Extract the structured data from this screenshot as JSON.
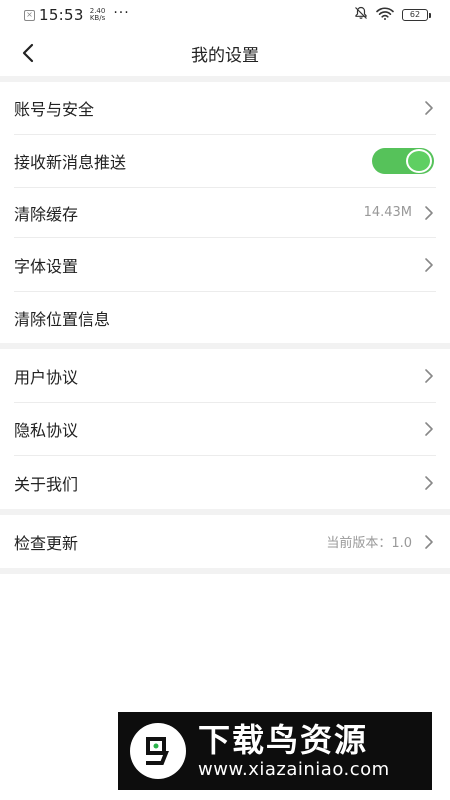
{
  "status_bar": {
    "time": "15:53",
    "speed_value": "2.40",
    "speed_unit": "KB/s",
    "more_dots": "···",
    "battery": "62"
  },
  "header": {
    "title": "我的设置"
  },
  "groups": [
    {
      "items": [
        {
          "label": "账号与安全",
          "value": "",
          "control": "chevron"
        },
        {
          "label": "接收新消息推送",
          "value": "",
          "control": "toggle",
          "toggle_on": true
        },
        {
          "label": "清除缓存",
          "value": "14.43M",
          "control": "chevron"
        },
        {
          "label": "字体设置",
          "value": "",
          "control": "chevron"
        },
        {
          "label": "清除位置信息",
          "value": "",
          "control": "none"
        }
      ]
    },
    {
      "items": [
        {
          "label": "用户协议",
          "value": "",
          "control": "chevron"
        },
        {
          "label": "隐私协议",
          "value": "",
          "control": "chevron"
        },
        {
          "label": "关于我们",
          "value": "",
          "control": "chevron"
        }
      ]
    },
    {
      "items": [
        {
          "label": "检查更新",
          "value": "当前版本：1.0",
          "control": "chevron"
        }
      ]
    }
  ],
  "watermark": {
    "title": "下载鸟资源",
    "url": "www.xiazainiao.com"
  },
  "colors": {
    "toggle_on": "#56c25a",
    "separator": "#f2f2f2",
    "text_primary": "#222222",
    "text_secondary": "#999999"
  },
  "icons": {
    "back": "chevron-left-icon",
    "row_arrow": "chevron-right-icon",
    "mute": "bell-off-icon",
    "wifi": "wifi-icon",
    "battery": "battery-icon"
  }
}
